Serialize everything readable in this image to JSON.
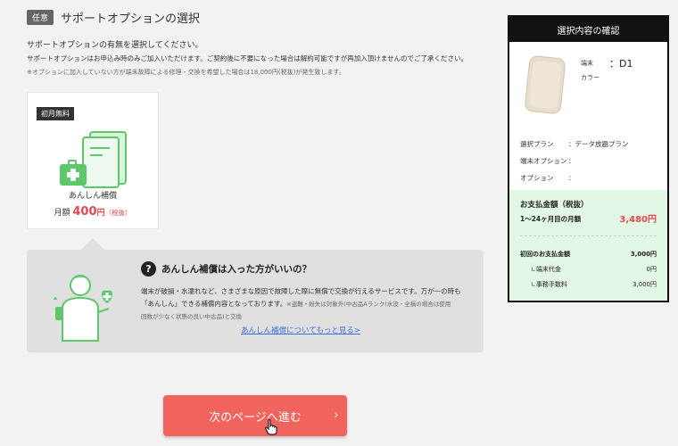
{
  "section": {
    "tag": "任意",
    "title": "サポートオプションの選択"
  },
  "descriptions": {
    "line1": "サポートオプションの有無を選択してください。",
    "line2": "サポートオプションはお申込み時のみご加入いただけます。ご契約後に不要になった場合は解約可能ですが再加入頂けませんのでご了承ください。",
    "line3": "※オプションに加入していない方が端末故障による修理・交換を希望した場合は18,000円(税抜)が発生致します。"
  },
  "option_card": {
    "badge": "初月無料",
    "name": "あんしん補償",
    "price_prefix": "月額",
    "price_value": "400",
    "price_unit": "円",
    "price_tax": "（税抜）"
  },
  "faq": {
    "question_icon": "?",
    "title": "あんしん補償は入った方がいいの？",
    "body_line1": "端末が破損・水濡れなど、さまざまな原因で故障した際に無償で交換が行えるサービスです。万が一の時も",
    "body_line2": "「あんしん」できる補償内容となっております。",
    "body_note1": "※盗難・紛失は対象外(中古品Aランク(水没・全損の場合は使用",
    "body_note2": "回数が少なく状態の良い中古品)と交換",
    "link": "あんしん補償についてもっと見る>"
  },
  "next_button": {
    "label": "次のページへ進む",
    "chevron": "›"
  },
  "summary": {
    "header": "選択内容の確認",
    "device_label": "端末",
    "device_value": "：D1",
    "color_label": "カラー",
    "rows": [
      {
        "key": "選択プラン",
        "value": "：データ放題プラン"
      },
      {
        "key": "端末オプション",
        "value": "："
      },
      {
        "key": "オプション",
        "value": "："
      }
    ],
    "payment_title": "お支払金額（税抜）",
    "monthly_label": "1～24ヶ月目の月額",
    "monthly_value": "3,480円",
    "initial_label": "初回のお支払金額",
    "initial_value": "3,000円",
    "device_cost_label": "∟端末代金",
    "device_cost_value": "0円",
    "fee_label": "∟事務手数料",
    "fee_value": "3,000円"
  },
  "colors": {
    "accent_red": "#e5484d",
    "button_red": "#f0645d",
    "green": "#5cc86a",
    "summary_green_bg": "#e3f7e6",
    "link_blue": "#3a6fd8"
  }
}
